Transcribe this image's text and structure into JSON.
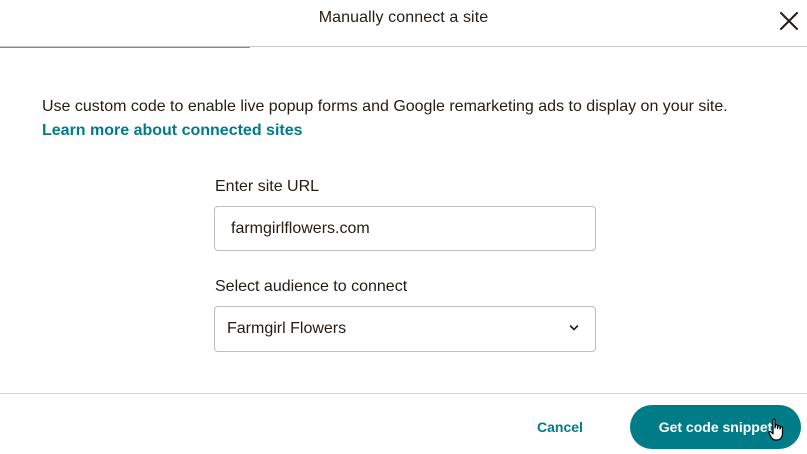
{
  "header": {
    "title": "Manually connect a site",
    "close_icon": "close-icon"
  },
  "body": {
    "description": "Use custom code to enable live popup forms and Google remarketing ads to display on your site.",
    "learn_more_link": "Learn more about connected sites",
    "url_field": {
      "label": "Enter site URL",
      "value": "farmgirlflowers.com"
    },
    "audience_field": {
      "label": "Select audience to connect",
      "selected": "Farmgirl Flowers",
      "icon": "chevron-down-icon"
    }
  },
  "footer": {
    "cancel_label": "Cancel",
    "primary_label": "Get code snippet"
  },
  "colors": {
    "accent": "#007c89",
    "text": "#241c15",
    "border": "#bdbdbd"
  }
}
